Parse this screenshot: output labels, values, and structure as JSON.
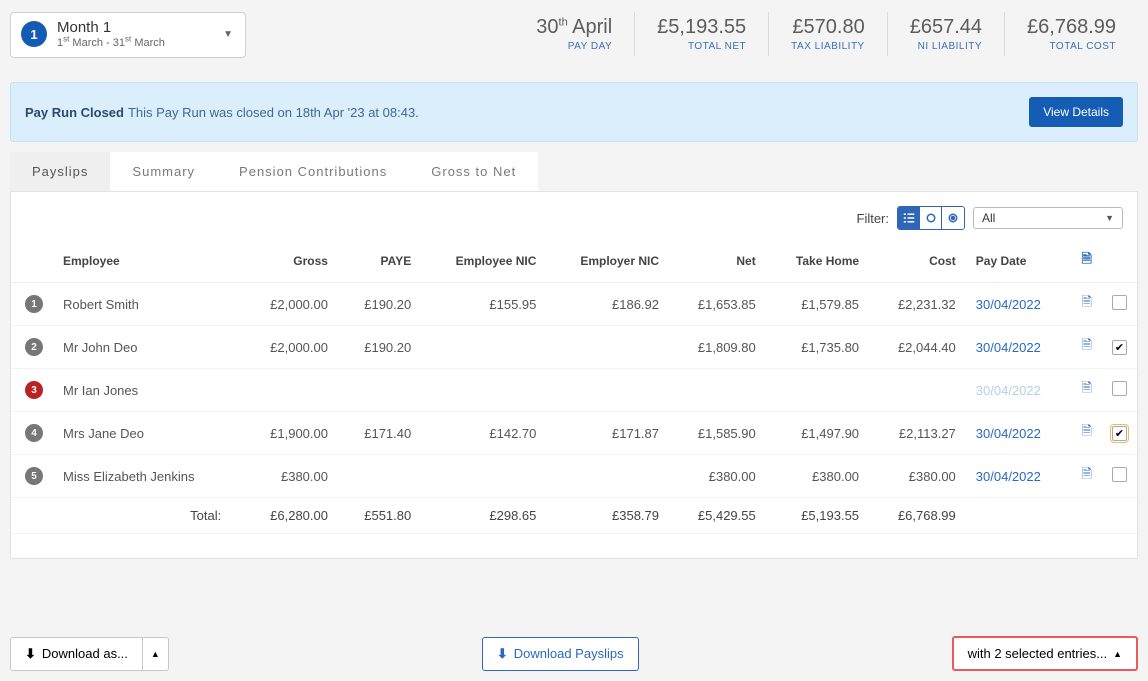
{
  "period": {
    "badge": "1",
    "title": "Month 1",
    "range_from_day": "1",
    "range_from_sup": "st",
    "range_from_month": "March",
    "range_to_day": "31",
    "range_to_sup": "st",
    "range_to_month": "March"
  },
  "stats": {
    "payday_day": "30",
    "payday_sup": "th",
    "payday_month": "April",
    "payday_label": "PAY DAY",
    "net_value": "£5,193.55",
    "net_label": "TOTAL NET",
    "tax_value": "£570.80",
    "tax_label": "TAX LIABILITY",
    "ni_value": "£657.44",
    "ni_label": "NI LIABILITY",
    "cost_value": "£6,768.99",
    "cost_label": "TOTAL COST"
  },
  "alert": {
    "title": "Pay Run Closed",
    "text": "This Pay Run was closed on 18th Apr '23 at 08:43.",
    "button": "View Details"
  },
  "tabs": {
    "payslips": "Payslips",
    "summary": "Summary",
    "pension": "Pension Contributions",
    "gross": "Gross to Net"
  },
  "filter": {
    "label": "Filter:",
    "dropdown": "All"
  },
  "columns": {
    "employee": "Employee",
    "gross": "Gross",
    "paye": "PAYE",
    "emp_nic": "Employee NIC",
    "empr_nic": "Employer NIC",
    "net": "Net",
    "take_home": "Take Home",
    "cost": "Cost",
    "pay_date": "Pay Date"
  },
  "rows": [
    {
      "idx": "1",
      "badge_color": "grey",
      "employee": "Robert Smith",
      "gross": "£2,000.00",
      "paye": "£190.20",
      "emp_nic": "£155.95",
      "empr_nic": "£186.92",
      "net": "£1,653.85",
      "take_home": "£1,579.85",
      "cost": "£2,231.32",
      "pay_date": "30/04/2022",
      "muted": false,
      "checked": false,
      "hl": false
    },
    {
      "idx": "2",
      "badge_color": "grey",
      "employee": "Mr John Deo",
      "gross": "£2,000.00",
      "paye": "£190.20",
      "emp_nic": "",
      "empr_nic": "",
      "net": "£1,809.80",
      "take_home": "£1,735.80",
      "cost": "£2,044.40",
      "pay_date": "30/04/2022",
      "muted": false,
      "checked": true,
      "hl": false
    },
    {
      "idx": "3",
      "badge_color": "red",
      "employee": "Mr Ian Jones",
      "gross": "",
      "paye": "",
      "emp_nic": "",
      "empr_nic": "",
      "net": "",
      "take_home": "",
      "cost": "",
      "pay_date": "30/04/2022",
      "muted": true,
      "checked": false,
      "hl": false
    },
    {
      "idx": "4",
      "badge_color": "grey",
      "employee": "Mrs Jane Deo",
      "gross": "£1,900.00",
      "paye": "£171.40",
      "emp_nic": "£142.70",
      "empr_nic": "£171.87",
      "net": "£1,585.90",
      "take_home": "£1,497.90",
      "cost": "£2,113.27",
      "pay_date": "30/04/2022",
      "muted": false,
      "checked": true,
      "hl": true
    },
    {
      "idx": "5",
      "badge_color": "grey",
      "employee": "Miss Elizabeth Jenkins",
      "gross": "£380.00",
      "paye": "",
      "emp_nic": "",
      "empr_nic": "",
      "net": "£380.00",
      "take_home": "£380.00",
      "cost": "£380.00",
      "pay_date": "30/04/2022",
      "muted": false,
      "checked": false,
      "hl": false
    }
  ],
  "totals": {
    "label": "Total:",
    "gross": "£6,280.00",
    "paye": "£551.80",
    "emp_nic": "£298.65",
    "empr_nic": "£358.79",
    "net": "£5,429.55",
    "take_home": "£5,193.55",
    "cost": "£6,768.99"
  },
  "footer": {
    "download_as": "Download as...",
    "download_payslips": "Download Payslips",
    "selected_entries": "with 2 selected entries..."
  }
}
